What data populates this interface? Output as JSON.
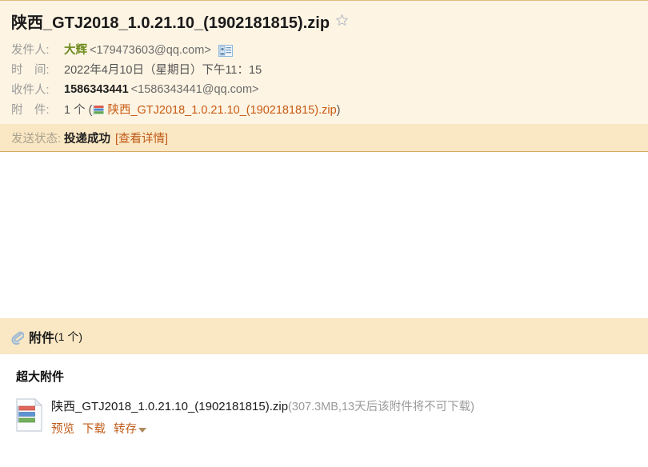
{
  "mail": {
    "subject": "陕西_GTJ2018_1.0.21.10_(1902181815).zip",
    "star_icon": "star-outline-icon",
    "meta": {
      "from_label": "发件人:",
      "from_name": "大辉",
      "from_email": "<179473603@qq.com>",
      "contact_icon": "contact-card-icon",
      "time_label": "时　间:",
      "time_value": "2022年4月10日（星期日）下午11：15",
      "to_label": "收件人:",
      "to_name": "1586343441",
      "to_email": "<1586343441@qq.com>",
      "attach_label": "附　件:",
      "attach_count": "1 个",
      "attach_open_paren": "(",
      "attach_icon": "zip-stripes-icon",
      "attach_name": "陕西_GTJ2018_1.0.21.10_(1902181815).zip",
      "attach_close_paren": ")"
    },
    "status": {
      "label": "发送状态:",
      "value": "投递成功",
      "detail_link": "[查看详情]"
    }
  },
  "attachments_panel": {
    "clip_icon": "paperclip-icon",
    "title": "附件",
    "count_text": "(1 个)",
    "group_title": "超大附件",
    "items": [
      {
        "file_icon": "zip-document-icon",
        "filename": "陕西_GTJ2018_1.0.21.10_(1902181815).zip",
        "meta": "(307.3MB,13天后该附件将不可下载)",
        "actions": [
          "预览",
          "下载",
          "转存"
        ],
        "dropdown_icon": "caret-down-icon"
      }
    ]
  },
  "colors": {
    "header_bg": "#FDF4E3",
    "status_bg": "#FAE7C3",
    "link": "#C05A18",
    "sender_name": "#6E8B1F",
    "muted": "#9b9b9b"
  }
}
